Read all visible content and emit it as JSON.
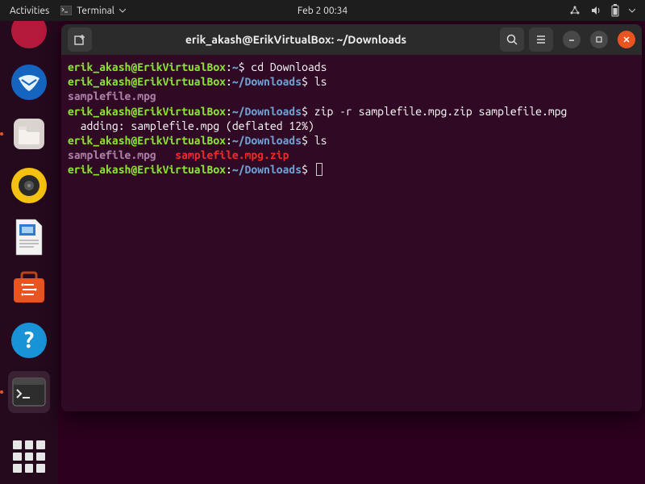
{
  "topbar": {
    "activities": "Activities",
    "terminal": "Terminal",
    "datetime": "Feb 2  00:34"
  },
  "window": {
    "title": "erik_akash@ErikVirtualBox: ~/Downloads"
  },
  "prompt": {
    "userhost": "erik_akash@ErikVirtualBox",
    "home": "~",
    "downloads": "~/Downloads",
    "sep": ":",
    "dollar": "$"
  },
  "lines": {
    "cmd1": " cd Downloads",
    "cmd2": " ls",
    "out2": "samplefile.mpg",
    "cmd3": " zip -r samplefile.mpg.zip samplefile.mpg",
    "out3": "  adding: samplefile.mpg (deflated 12%)",
    "cmd4": " ls",
    "out4a": "samplefile.mpg",
    "out4gap": "   ",
    "out4b": "samplefile.mpg.zip",
    "cmd5": " "
  }
}
